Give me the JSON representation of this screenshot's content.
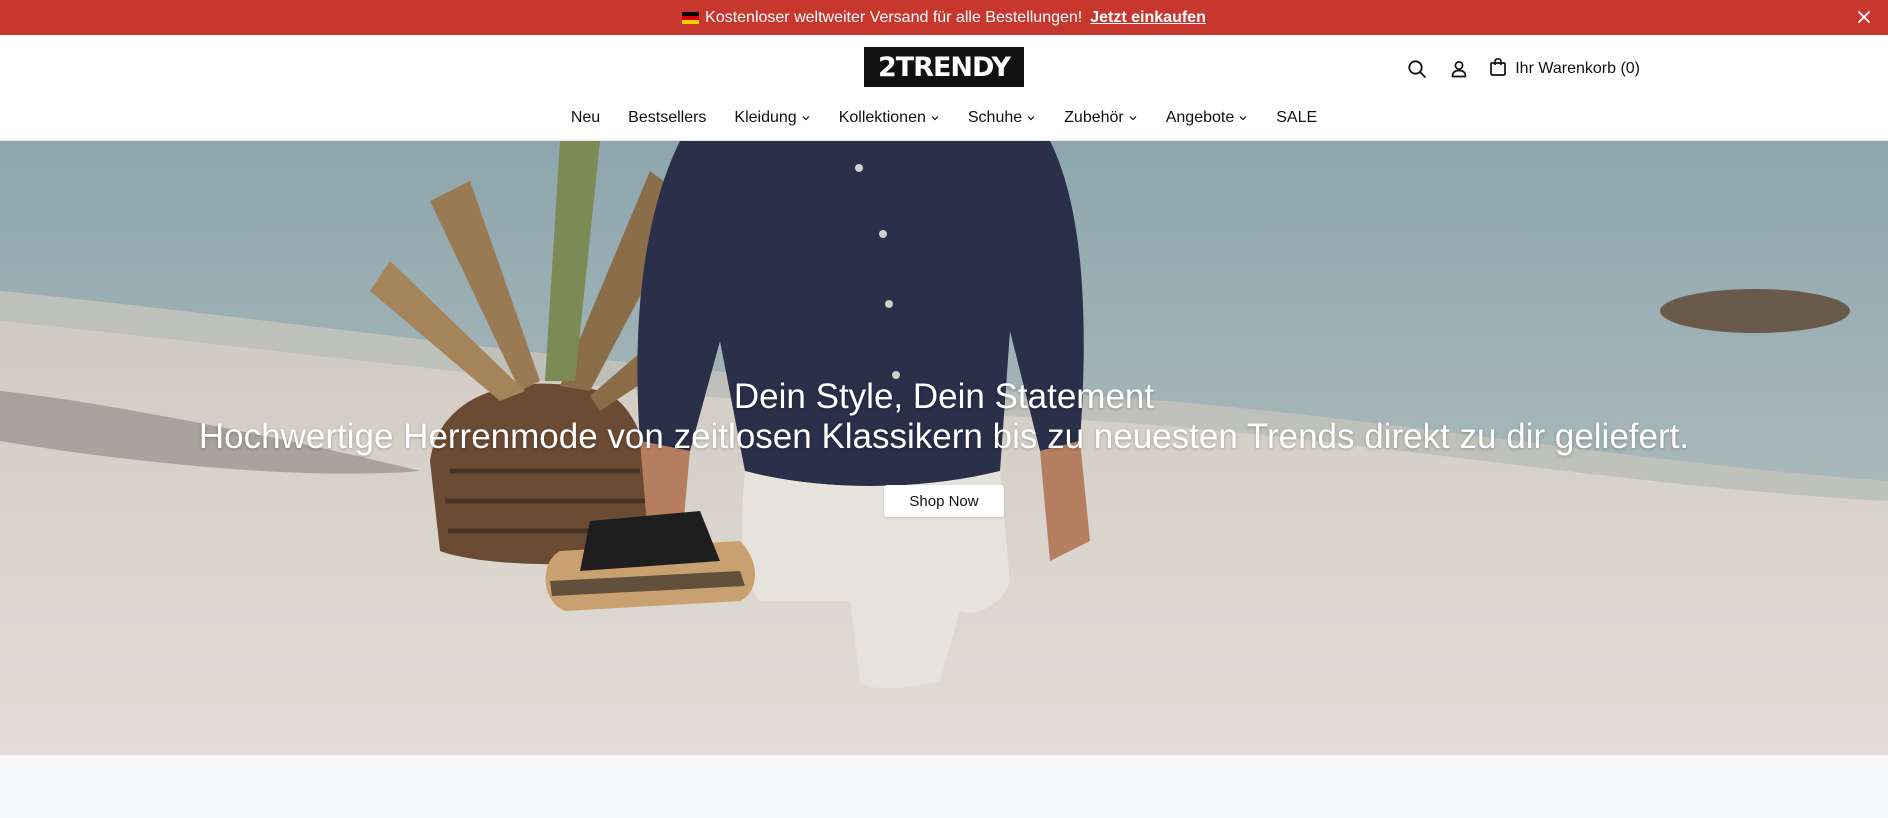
{
  "announcement": {
    "message": "Kostenloser weltweiter Versand für alle Bestellungen!",
    "link_label": "Jetzt einkaufen",
    "flag_icon": "germany-flag-icon",
    "flag_colors": [
      "#000000",
      "#dd0000",
      "#ffce00"
    ],
    "close_icon": "close-icon",
    "background": "#c8372d"
  },
  "header": {
    "logo_text": "2TRENDY",
    "search_icon": "search-icon",
    "account_icon": "user-icon",
    "cart_icon": "shopping-bag-icon",
    "cart_label": "Ihr Warenkorb (0)"
  },
  "nav": {
    "items": [
      {
        "label": "Neu",
        "has_dropdown": false
      },
      {
        "label": "Bestsellers",
        "has_dropdown": false
      },
      {
        "label": "Kleidung",
        "has_dropdown": true
      },
      {
        "label": "Kollektionen",
        "has_dropdown": true
      },
      {
        "label": "Schuhe",
        "has_dropdown": true
      },
      {
        "label": "Zubehör",
        "has_dropdown": true
      },
      {
        "label": "Angebote",
        "has_dropdown": true
      },
      {
        "label": "SALE",
        "has_dropdown": false
      }
    ]
  },
  "hero": {
    "title": "Dein Style, Dein Statement",
    "subtitle": "Hochwertige Herrenmode von zeitlosen Klassikern bis zu neuesten Trends direkt zu dir geliefert.",
    "button_label": "Shop Now"
  }
}
